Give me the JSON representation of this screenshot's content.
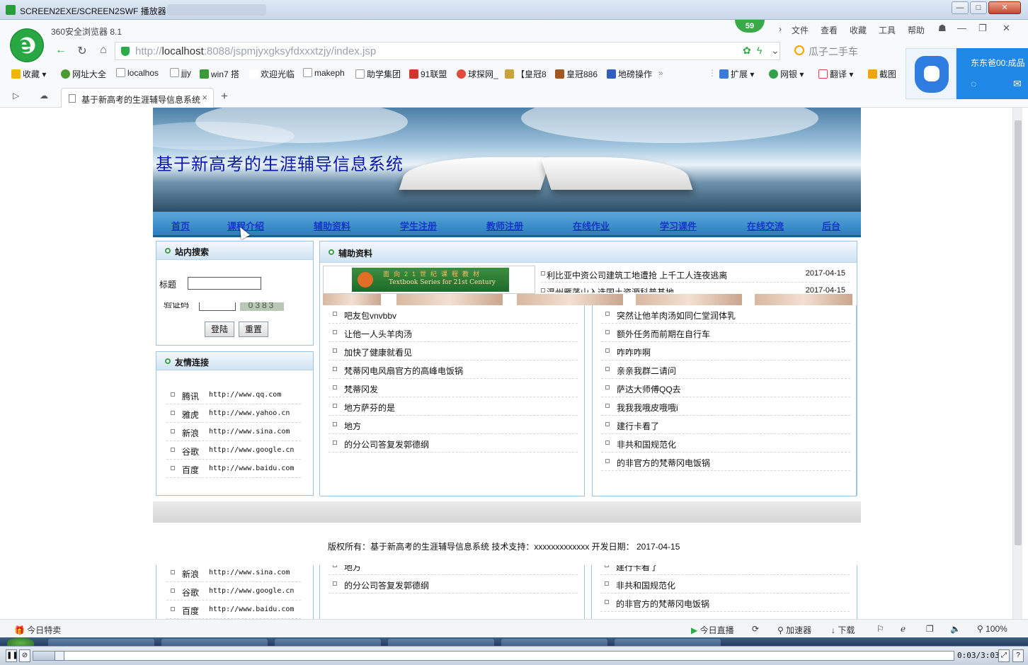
{
  "player": {
    "title": "SCREEN2EXE/SCREEN2SWF 播放器",
    "time": "0:03/3:03"
  },
  "browser": {
    "version": "360安全浏览器 8.1",
    "badge": "59",
    "menu": [
      "文件",
      "查看",
      "收藏",
      "工具",
      "帮助"
    ],
    "url_host": "http://",
    "url_domain": "localhost",
    "url_rest": ":8088/jspmjyxgksyfdxxxtzjy/index.jsp",
    "search_placeholder": "瓜子二手车",
    "bookmarks": [
      "收藏",
      "网址大全",
      "localhos",
      "jjjy",
      "win7 搭",
      "欢迎光临",
      "makeph",
      "助学集团",
      "91联盟",
      "球探网_",
      "【皇冠8",
      "皇冠886",
      "地磅操作",
      "扩展",
      "网银",
      "翻译",
      "截图"
    ],
    "tab_label": "基于新高考的生涯辅导信息系统",
    "popup_text": "东东爸00:成品",
    "status_left": "今日特卖",
    "status_items": [
      "今日直播",
      "加速器",
      "下载",
      "100%"
    ]
  },
  "site": {
    "title": "基于新高考的生涯辅导信息系统",
    "nav": [
      "首页",
      "课程介绍",
      "辅助资料",
      "学生注册",
      "教师注册",
      "在线作业",
      "学习课件",
      "在线交流",
      "后台"
    ],
    "search": {
      "header": "站内搜索",
      "title_label": "标题",
      "captcha_label": "验证码",
      "captcha_text": "0383",
      "login": "登陆",
      "reset": "重置"
    },
    "links": {
      "header": "友情连接",
      "items": [
        {
          "name": "腾讯",
          "url": "http://www.qq.com"
        },
        {
          "name": "雅虎",
          "url": "http://www.yahoo.cn"
        },
        {
          "name": "新浪",
          "url": "http://www.sina.com"
        },
        {
          "name": "谷歌",
          "url": "http://www.google.cn"
        },
        {
          "name": "百度",
          "url": "http://www.baidu.com"
        }
      ]
    },
    "materials": {
      "header": "辅助资料",
      "textbook_line1": "面向21世纪课程教材",
      "textbook_line2": "Textbook Series for 21st Century",
      "news": [
        {
          "title": "利比亚中资公司建筑工地遭抢 上千工人连夜逃离",
          "date": "2017-04-15"
        },
        {
          "title": "温州雁荡山入选国土资源科普基地",
          "date": "2017-04-15"
        }
      ],
      "left_list": [
        "吧友包vnvbbv",
        "让他一人头羊肉汤",
        "加快了健康就看见",
        "梵蒂冈电风扇官方的高峰电饭锅",
        "梵蒂冈发",
        "地方萨芬的是",
        "地方",
        "的分公司答复发郭德纲"
      ],
      "right_list": [
        "突然让他羊肉汤如同仁堂润体乳",
        "额外任务而前期在自行车",
        "咋咋咋啊",
        "亲亲我群二请问",
        "萨达大师傅QQ去",
        "我我我哦皮哦哦i",
        "建行卡看了",
        "非共和国规范化",
        "的非官方的梵蒂冈电饭锅"
      ]
    },
    "copyright": "版权所有：基于新高考的生涯辅导信息系统 技术支持：xxxxxxxxxxxxx 开发日期： 2017-04-15",
    "ghost": {
      "links": [
        {
          "name": "新浪",
          "url": "http://www.sina.com"
        },
        {
          "name": "谷歌",
          "url": "http://www.google.cn"
        },
        {
          "name": "百度",
          "url": "http://www.baidu.com"
        }
      ],
      "left": [
        "地方",
        "的分公司答复发郭德纲"
      ],
      "right": [
        "建行卡看了",
        "非共和国规范化",
        "的非官方的梵蒂冈电饭锅"
      ]
    }
  }
}
